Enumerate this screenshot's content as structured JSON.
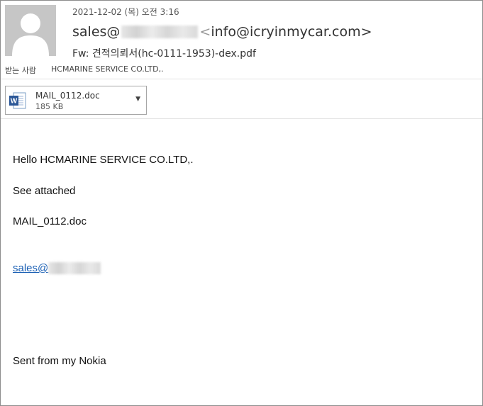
{
  "header": {
    "date": "2021-12-02 (목) 오전 3:16",
    "from_user": "sales@",
    "from_open": "<",
    "from_email": "info@icryinmycar.com",
    "from_close": ">",
    "subject": "Fw: 견적의뢰서(hc-0111-1953)-dex.pdf",
    "to_label": "받는 사람",
    "to_value": "HCMARINE SERVICE CO.LTD,."
  },
  "attachment": {
    "name": "MAIL_0112.doc",
    "size": "185 KB",
    "icon": "word-doc-icon"
  },
  "body": {
    "greeting": "Hello HCMARINE SERVICE CO.LTD,.",
    "line1": "See attached",
    "line2": "MAIL_0112.doc",
    "link": "sales@",
    "signature": "Sent from my Nokia"
  }
}
